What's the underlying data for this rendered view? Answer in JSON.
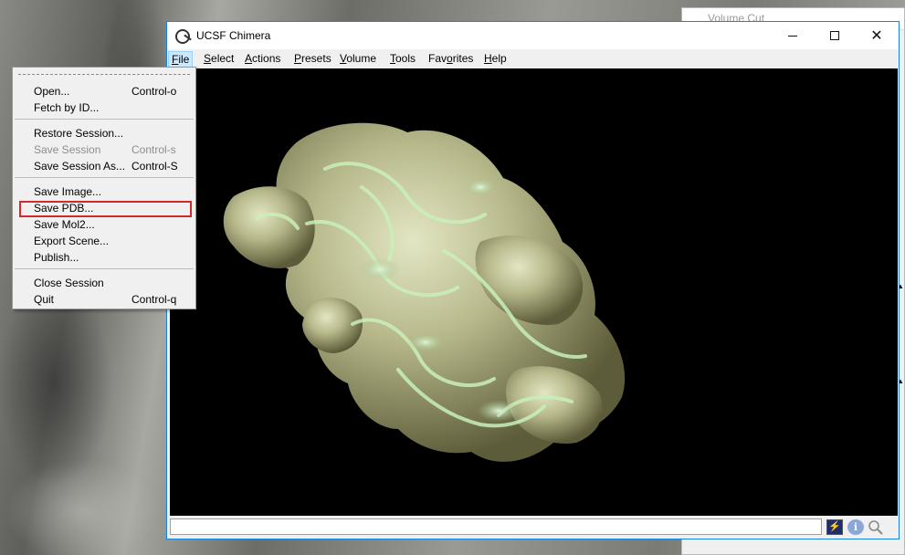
{
  "background_window": {
    "title": "Volume Cut"
  },
  "window": {
    "title": "UCSF Chimera",
    "controls": {
      "minimize": "─",
      "maximize": "☐",
      "close": "✕"
    }
  },
  "menu_bar": {
    "items": [
      {
        "label": "File",
        "mnemonic": "F",
        "rest": "ile",
        "active": true
      },
      {
        "label": "Select",
        "mnemonic": "S",
        "rest": "elect"
      },
      {
        "label": "Actions",
        "mnemonic": "A",
        "rest": "ctions"
      },
      {
        "label": "Presets",
        "mnemonic": "P",
        "rest": "resets"
      },
      {
        "label": "Volume",
        "mnemonic": "V",
        "rest": "olume"
      },
      {
        "label": "Tools",
        "mnemonic": "T",
        "rest": "ools"
      },
      {
        "label": "Favorites",
        "mnemonic": "o",
        "pre": "Fav",
        "rest": "rites"
      },
      {
        "label": "Help",
        "mnemonic": "H",
        "rest": "elp"
      }
    ]
  },
  "file_menu": {
    "items": [
      {
        "label": "Open...",
        "accel": "Control-o",
        "enabled": true
      },
      {
        "label": "Fetch by ID...",
        "accel": "",
        "enabled": true
      },
      {
        "label": "Restore Session...",
        "accel": "",
        "enabled": true
      },
      {
        "label": "Save Session",
        "accel": "Control-s",
        "enabled": false
      },
      {
        "label": "Save Session As...",
        "accel": "Control-S",
        "enabled": true
      },
      {
        "label": "Save Image...",
        "accel": "",
        "enabled": true
      },
      {
        "label": "Save PDB...",
        "accel": "",
        "enabled": true,
        "highlighted": true
      },
      {
        "label": "Save Mol2...",
        "accel": "",
        "enabled": true
      },
      {
        "label": "Export Scene...",
        "accel": "",
        "enabled": true
      },
      {
        "label": "Publish...",
        "accel": "",
        "enabled": true
      },
      {
        "label": "Close Session",
        "accel": "",
        "enabled": true
      },
      {
        "label": "Quit",
        "accel": "Control-q",
        "enabled": true
      }
    ]
  },
  "status_bar": {
    "command_value": "",
    "icons": [
      "bolt-icon",
      "info-icon",
      "magnifier-icon"
    ]
  },
  "colors": {
    "viewport_bg": "#000000",
    "highlight_border": "#d22b2b",
    "surface": "#a9ad7c",
    "ribbon": "#b9e8b0"
  }
}
